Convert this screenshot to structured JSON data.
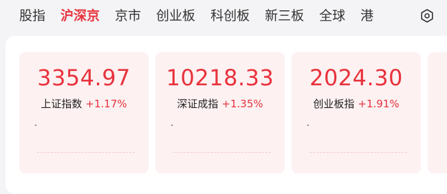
{
  "tabs": [
    {
      "label": "股指",
      "active": false
    },
    {
      "label": "沪深京",
      "active": true
    },
    {
      "label": "京市",
      "active": false
    },
    {
      "label": "创业板",
      "active": false
    },
    {
      "label": "科创板",
      "active": false
    },
    {
      "label": "新三板",
      "active": false
    },
    {
      "label": "全球",
      "active": false
    },
    {
      "label": "港",
      "active": false
    }
  ],
  "settings_icon": "settings-icon",
  "cards": [
    {
      "value": "3354.97",
      "name": "上证指数",
      "change": "+1.17%"
    },
    {
      "value": "10218.33",
      "name": "深证成指",
      "change": "+1.35%"
    },
    {
      "value": "2024.30",
      "name": "创业板指",
      "change": "+1.91%"
    }
  ],
  "colors": {
    "accent": "#e8323c",
    "card_bg": "#fdf1f2",
    "page_bg": "#f4f4f6"
  }
}
